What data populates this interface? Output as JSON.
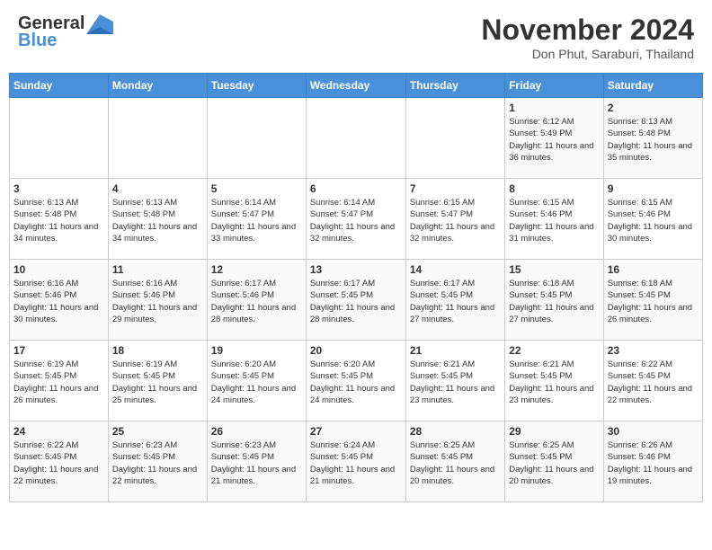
{
  "header": {
    "logo_general": "General",
    "logo_blue": "Blue",
    "month": "November 2024",
    "location": "Don Phut, Saraburi, Thailand"
  },
  "weekdays": [
    "Sunday",
    "Monday",
    "Tuesday",
    "Wednesday",
    "Thursday",
    "Friday",
    "Saturday"
  ],
  "weeks": [
    [
      {
        "day": "",
        "info": ""
      },
      {
        "day": "",
        "info": ""
      },
      {
        "day": "",
        "info": ""
      },
      {
        "day": "",
        "info": ""
      },
      {
        "day": "",
        "info": ""
      },
      {
        "day": "1",
        "info": "Sunrise: 6:12 AM\nSunset: 5:49 PM\nDaylight: 11 hours and 36 minutes."
      },
      {
        "day": "2",
        "info": "Sunrise: 6:13 AM\nSunset: 5:48 PM\nDaylight: 11 hours and 35 minutes."
      }
    ],
    [
      {
        "day": "3",
        "info": "Sunrise: 6:13 AM\nSunset: 5:48 PM\nDaylight: 11 hours and 34 minutes."
      },
      {
        "day": "4",
        "info": "Sunrise: 6:13 AM\nSunset: 5:48 PM\nDaylight: 11 hours and 34 minutes."
      },
      {
        "day": "5",
        "info": "Sunrise: 6:14 AM\nSunset: 5:47 PM\nDaylight: 11 hours and 33 minutes."
      },
      {
        "day": "6",
        "info": "Sunrise: 6:14 AM\nSunset: 5:47 PM\nDaylight: 11 hours and 32 minutes."
      },
      {
        "day": "7",
        "info": "Sunrise: 6:15 AM\nSunset: 5:47 PM\nDaylight: 11 hours and 32 minutes."
      },
      {
        "day": "8",
        "info": "Sunrise: 6:15 AM\nSunset: 5:46 PM\nDaylight: 11 hours and 31 minutes."
      },
      {
        "day": "9",
        "info": "Sunrise: 6:15 AM\nSunset: 5:46 PM\nDaylight: 11 hours and 30 minutes."
      }
    ],
    [
      {
        "day": "10",
        "info": "Sunrise: 6:16 AM\nSunset: 5:46 PM\nDaylight: 11 hours and 30 minutes."
      },
      {
        "day": "11",
        "info": "Sunrise: 6:16 AM\nSunset: 5:46 PM\nDaylight: 11 hours and 29 minutes."
      },
      {
        "day": "12",
        "info": "Sunrise: 6:17 AM\nSunset: 5:46 PM\nDaylight: 11 hours and 28 minutes."
      },
      {
        "day": "13",
        "info": "Sunrise: 6:17 AM\nSunset: 5:45 PM\nDaylight: 11 hours and 28 minutes."
      },
      {
        "day": "14",
        "info": "Sunrise: 6:17 AM\nSunset: 5:45 PM\nDaylight: 11 hours and 27 minutes."
      },
      {
        "day": "15",
        "info": "Sunrise: 6:18 AM\nSunset: 5:45 PM\nDaylight: 11 hours and 27 minutes."
      },
      {
        "day": "16",
        "info": "Sunrise: 6:18 AM\nSunset: 5:45 PM\nDaylight: 11 hours and 26 minutes."
      }
    ],
    [
      {
        "day": "17",
        "info": "Sunrise: 6:19 AM\nSunset: 5:45 PM\nDaylight: 11 hours and 26 minutes."
      },
      {
        "day": "18",
        "info": "Sunrise: 6:19 AM\nSunset: 5:45 PM\nDaylight: 11 hours and 25 minutes."
      },
      {
        "day": "19",
        "info": "Sunrise: 6:20 AM\nSunset: 5:45 PM\nDaylight: 11 hours and 24 minutes."
      },
      {
        "day": "20",
        "info": "Sunrise: 6:20 AM\nSunset: 5:45 PM\nDaylight: 11 hours and 24 minutes."
      },
      {
        "day": "21",
        "info": "Sunrise: 6:21 AM\nSunset: 5:45 PM\nDaylight: 11 hours and 23 minutes."
      },
      {
        "day": "22",
        "info": "Sunrise: 6:21 AM\nSunset: 5:45 PM\nDaylight: 11 hours and 23 minutes."
      },
      {
        "day": "23",
        "info": "Sunrise: 6:22 AM\nSunset: 5:45 PM\nDaylight: 11 hours and 22 minutes."
      }
    ],
    [
      {
        "day": "24",
        "info": "Sunrise: 6:22 AM\nSunset: 5:45 PM\nDaylight: 11 hours and 22 minutes."
      },
      {
        "day": "25",
        "info": "Sunrise: 6:23 AM\nSunset: 5:45 PM\nDaylight: 11 hours and 22 minutes."
      },
      {
        "day": "26",
        "info": "Sunrise: 6:23 AM\nSunset: 5:45 PM\nDaylight: 11 hours and 21 minutes."
      },
      {
        "day": "27",
        "info": "Sunrise: 6:24 AM\nSunset: 5:45 PM\nDaylight: 11 hours and 21 minutes."
      },
      {
        "day": "28",
        "info": "Sunrise: 6:25 AM\nSunset: 5:45 PM\nDaylight: 11 hours and 20 minutes."
      },
      {
        "day": "29",
        "info": "Sunrise: 6:25 AM\nSunset: 5:45 PM\nDaylight: 11 hours and 20 minutes."
      },
      {
        "day": "30",
        "info": "Sunrise: 6:26 AM\nSunset: 5:46 PM\nDaylight: 11 hours and 19 minutes."
      }
    ]
  ]
}
